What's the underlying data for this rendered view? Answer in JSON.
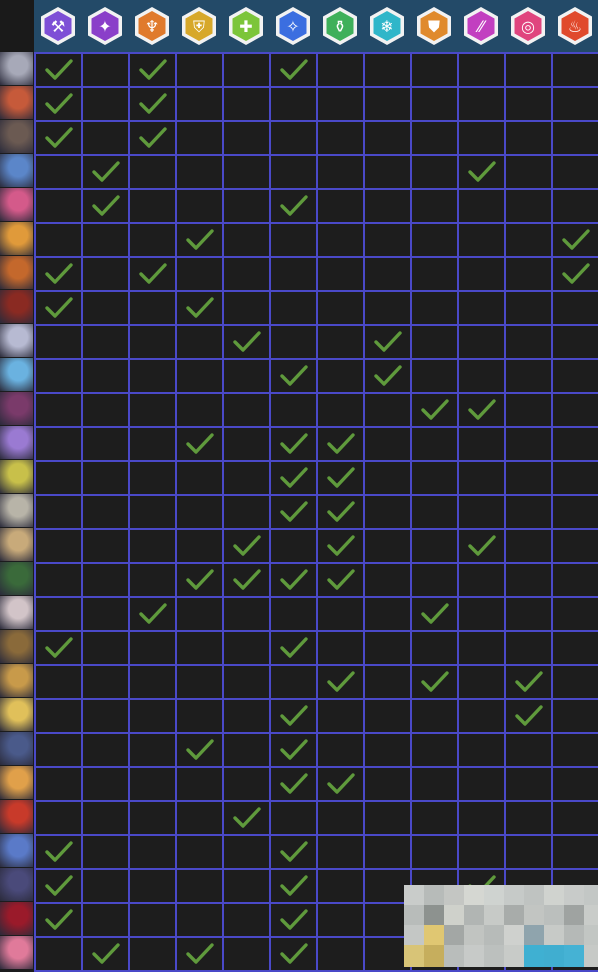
{
  "header": {
    "class_icons": [
      {
        "icon": "hammer-icon",
        "color": "#7e4fd6",
        "glyph": "⚒"
      },
      {
        "icon": "crystal-icon",
        "color": "#8a3fc9",
        "glyph": "✦"
      },
      {
        "icon": "torch-icon",
        "color": "#e07a2c",
        "glyph": "♆"
      },
      {
        "icon": "shield-hand-icon",
        "color": "#d7a82a",
        "glyph": "⛨"
      },
      {
        "icon": "cross-heal-icon",
        "color": "#7cc53a",
        "glyph": "✚"
      },
      {
        "icon": "sparkle-icon",
        "color": "#3b6ee0",
        "glyph": "✧"
      },
      {
        "icon": "potion-icon",
        "color": "#3fb05a",
        "glyph": "⚱"
      },
      {
        "icon": "snowflake-icon",
        "color": "#2fb6c9",
        "glyph": "❄"
      },
      {
        "icon": "shield-icon",
        "color": "#e08a2c",
        "glyph": "⛊"
      },
      {
        "icon": "claw-icon",
        "color": "#c23fc0",
        "glyph": "⁄⁄"
      },
      {
        "icon": "target-icon",
        "color": "#e0457e",
        "glyph": "◎"
      },
      {
        "icon": "flame-icon",
        "color": "#e04a2c",
        "glyph": "♨"
      }
    ]
  },
  "rows": [
    {
      "avatar": "champion-1-portrait",
      "tone": "#a7a9b8",
      "checks": [
        0,
        2,
        5
      ]
    },
    {
      "avatar": "champion-2-portrait",
      "tone": "#c65a3a",
      "checks": [
        0,
        2
      ]
    },
    {
      "avatar": "champion-3-portrait",
      "tone": "#6b5a52",
      "checks": [
        0,
        2
      ]
    },
    {
      "avatar": "champion-4-portrait",
      "tone": "#5b86c9",
      "checks": [
        1,
        9
      ]
    },
    {
      "avatar": "champion-5-portrait",
      "tone": "#d45a8a",
      "checks": [
        1,
        5
      ]
    },
    {
      "avatar": "champion-6-portrait",
      "tone": "#e09a3a",
      "checks": [
        3,
        11
      ]
    },
    {
      "avatar": "champion-7-portrait",
      "tone": "#c4682c",
      "checks": [
        0,
        2,
        11
      ]
    },
    {
      "avatar": "champion-8-portrait",
      "tone": "#8a2a22",
      "checks": [
        0,
        3
      ]
    },
    {
      "avatar": "champion-9-portrait",
      "tone": "#b7bad2",
      "checks": [
        4,
        7
      ]
    },
    {
      "avatar": "champion-10-portrait",
      "tone": "#6ab2e0",
      "checks": [
        5,
        7
      ]
    },
    {
      "avatar": "champion-11-portrait",
      "tone": "#7a3a6a",
      "checks": [
        8,
        9
      ]
    },
    {
      "avatar": "champion-12-portrait",
      "tone": "#9a7ad2",
      "checks": [
        3,
        5,
        6
      ]
    },
    {
      "avatar": "champion-13-portrait",
      "tone": "#c8c04a",
      "checks": [
        5,
        6
      ]
    },
    {
      "avatar": "champion-14-portrait",
      "tone": "#b8b4a8",
      "checks": [
        5,
        6
      ]
    },
    {
      "avatar": "champion-15-portrait",
      "tone": "#c8aa7a",
      "checks": [
        4,
        6,
        9
      ]
    },
    {
      "avatar": "champion-16-portrait",
      "tone": "#3a6a3a",
      "checks": [
        3,
        4,
        5,
        6
      ]
    },
    {
      "avatar": "champion-17-portrait",
      "tone": "#d2c4c8",
      "checks": [
        2,
        8
      ]
    },
    {
      "avatar": "champion-18-portrait",
      "tone": "#8a6a3a",
      "checks": [
        0,
        5
      ]
    },
    {
      "avatar": "champion-19-portrait",
      "tone": "#c89a4a",
      "checks": [
        6,
        8,
        10
      ]
    },
    {
      "avatar": "champion-20-portrait",
      "tone": "#e0c05a",
      "checks": [
        5,
        10
      ]
    },
    {
      "avatar": "champion-21-portrait",
      "tone": "#4a5a8a",
      "checks": [
        3,
        5
      ]
    },
    {
      "avatar": "champion-22-portrait",
      "tone": "#e0a04a",
      "checks": [
        5,
        6
      ]
    },
    {
      "avatar": "champion-23-portrait",
      "tone": "#c83a2a",
      "checks": [
        4
      ]
    },
    {
      "avatar": "champion-24-portrait",
      "tone": "#5a7ac8",
      "checks": [
        0,
        5
      ]
    },
    {
      "avatar": "champion-25-portrait",
      "tone": "#4a4a7a",
      "checks": [
        0,
        5,
        9
      ]
    },
    {
      "avatar": "champion-26-portrait",
      "tone": "#9a1a2a",
      "checks": [
        0,
        5
      ]
    },
    {
      "avatar": "champion-27-portrait",
      "tone": "#e07a9a",
      "checks": [
        1,
        3,
        5
      ]
    }
  ],
  "colors": {
    "grid_line": "#4a49c8",
    "cell_bg": "#1d1d1d",
    "check": "#5f9a3c",
    "header_bg": "#234a68"
  }
}
